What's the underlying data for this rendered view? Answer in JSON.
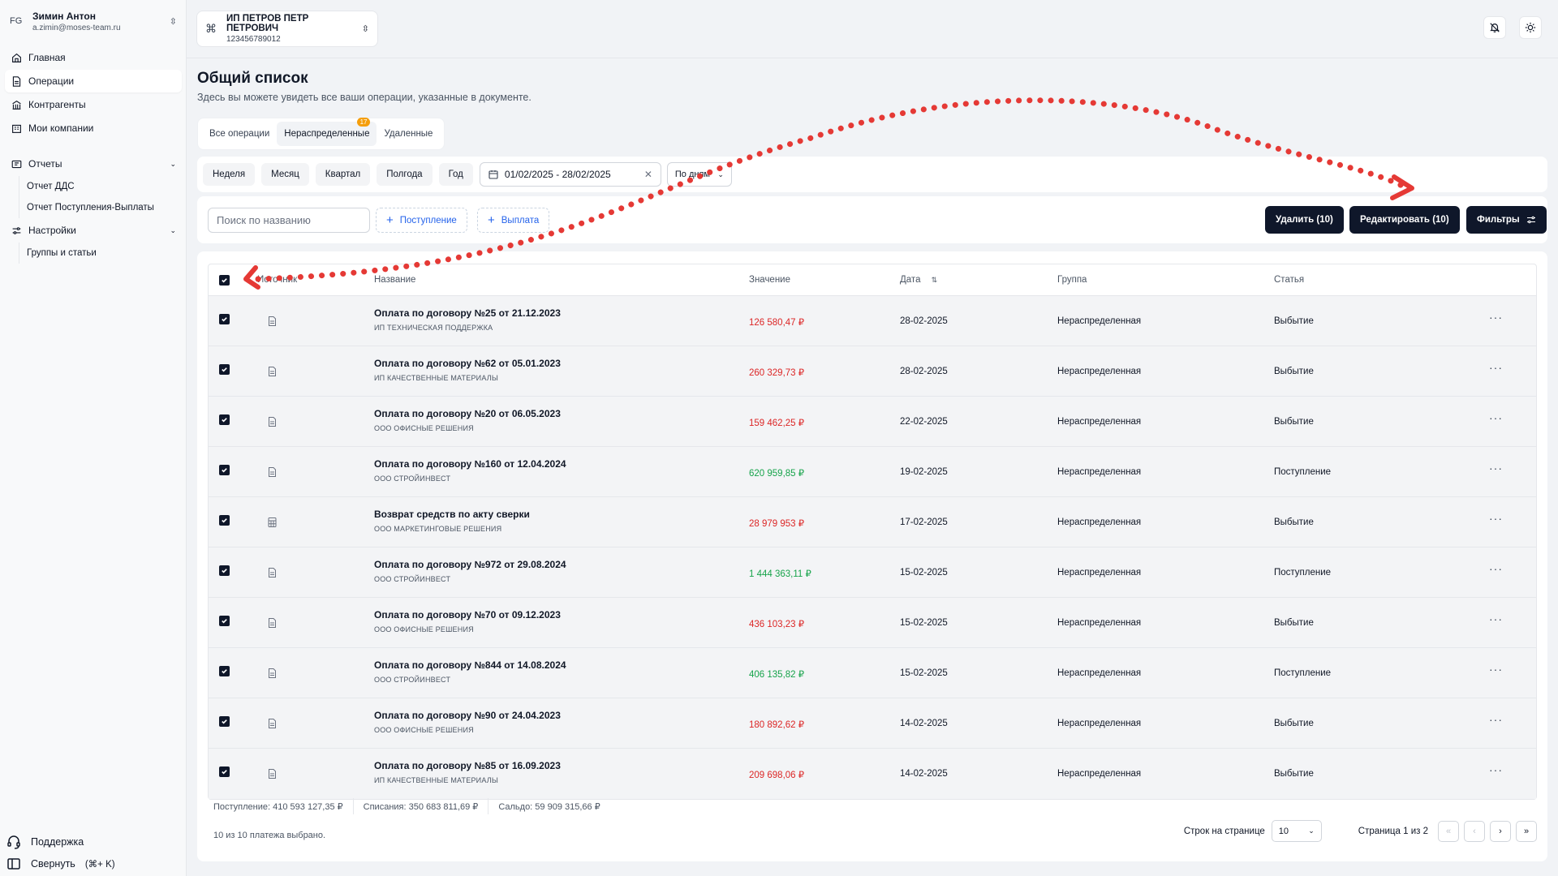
{
  "user": {
    "initials": "FG",
    "name": "Зимин Антон",
    "email": "a.zimin@moses-team.ru"
  },
  "nav": {
    "home": "Главная",
    "operations": "Операции",
    "counterparties": "Контрагенты",
    "companies": "Мои компании",
    "reports": "Отчеты",
    "report_dds": "Отчет ДДС",
    "report_flows": "Отчет Поступления-Выплаты",
    "settings": "Настройки",
    "groups": "Группы и статьи"
  },
  "sidebar_bottom": {
    "support": "Поддержка",
    "collapse": "Свернуть",
    "collapse_kbd": "(⌘+ K)"
  },
  "company": {
    "name": "ИП ПЕТРОВ ПЕТР ПЕТРОВИЧ",
    "inn": "123456789012"
  },
  "page": {
    "title": "Общий список",
    "subtitle": "Здесь вы можете увидеть все ваши операции, указанные в документе."
  },
  "tabs": {
    "all": "Все операции",
    "unassigned": "Нераспределенные",
    "unassigned_badge": "17",
    "deleted": "Удаленные"
  },
  "periods": {
    "week": "Неделя",
    "month": "Месяц",
    "quarter": "Квартал",
    "half": "Полгода",
    "year": "Год"
  },
  "date_range": "01/02/2025 - 28/02/2025",
  "grouping": "По дням",
  "search_placeholder": "Поиск по названию",
  "actions": {
    "income": "Поступление",
    "payment": "Выплата",
    "delete": "Удалить  (10)",
    "edit": "Редактировать  (10)",
    "filters": "Фильтры"
  },
  "columns": {
    "source": "Источник",
    "name": "Название",
    "value": "Значение",
    "date": "Дата",
    "group": "Группа",
    "article": "Статья"
  },
  "rows": [
    {
      "name": "Оплата по договору №25 от 21.12.2023",
      "counterparty": "ИП ТЕХНИЧЕСКАЯ ПОДДЕРЖКА",
      "value": "126 580,47 ₽",
      "date": "28-02-2025",
      "group": "Нераспределенная",
      "article": "Выбытие"
    },
    {
      "name": "Оплата по договору №62 от 05.01.2023",
      "counterparty": "ИП КАЧЕСТВЕННЫЕ МАТЕРИАЛЫ",
      "value": "260 329,73 ₽",
      "date": "28-02-2025",
      "group": "Нераспределенная",
      "article": "Выбытие"
    },
    {
      "name": "Оплата по договору №20 от 06.05.2023",
      "counterparty": "ООО ОФИСНЫЕ РЕШЕНИЯ",
      "value": "159 462,25 ₽",
      "date": "22-02-2025",
      "group": "Нераспределенная",
      "article": "Выбытие"
    },
    {
      "name": "Оплата по договору №160 от 12.04.2024",
      "counterparty": "ООО СТРОЙИНВЕСТ",
      "value": "620 959,85 ₽",
      "date": "19-02-2025",
      "group": "Нераспределенная",
      "article": "Поступление"
    },
    {
      "name": "Возврат средств по акту сверки",
      "counterparty": "ООО МАРКЕТИНГОВЫЕ РЕШЕНИЯ",
      "value": "28 979 953 ₽",
      "date": "17-02-2025",
      "group": "Нераспределенная",
      "article": "Выбытие"
    },
    {
      "name": "Оплата по договору №972 от 29.08.2024",
      "counterparty": "ООО СТРОЙИНВЕСТ",
      "value": "1 444 363,11 ₽",
      "date": "15-02-2025",
      "group": "Нераспределенная",
      "article": "Поступление"
    },
    {
      "name": "Оплата по договору №70 от 09.12.2023",
      "counterparty": "ООО ОФИСНЫЕ РЕШЕНИЯ",
      "value": "436 103,23 ₽",
      "date": "15-02-2025",
      "group": "Нераспределенная",
      "article": "Выбытие"
    },
    {
      "name": "Оплата по договору №844 от 14.08.2024",
      "counterparty": "ООО СТРОЙИНВЕСТ",
      "value": "406 135,82 ₽",
      "date": "15-02-2025",
      "group": "Нераспределенная",
      "article": "Поступление"
    },
    {
      "name": "Оплата по договору №90 от 24.04.2023",
      "counterparty": "ООО ОФИСНЫЕ РЕШЕНИЯ",
      "value": "180 892,62 ₽",
      "date": "14-02-2025",
      "group": "Нераспределенная",
      "article": "Выбытие"
    },
    {
      "name": "Оплата по договору №85 от 16.09.2023",
      "counterparty": "ИП КАЧЕСТВЕННЫЕ МАТЕРИАЛЫ",
      "value": "209 698,06 ₽",
      "date": "14-02-2025",
      "group": "Нераспределенная",
      "article": "Выбытие"
    }
  ],
  "summary": {
    "income": "Поступление: 410 593 127,35 ₽",
    "writeoffs": "Списания: 350 683 811,69 ₽",
    "balance": "Сальдо: 59 909 315,66 ₽"
  },
  "selected_text": "10 из 10 платежа выбрано.",
  "pagination": {
    "rows_label": "Строк на странице",
    "rows_value": "10",
    "page_label": "Страница 1 из 2",
    "first": "«",
    "prev": "‹",
    "next": "›",
    "last": "»"
  },
  "colors": {
    "negative": "#dc2626",
    "positive": "#16a34a",
    "dark": "#0f172a",
    "annotation": "#e53935"
  }
}
